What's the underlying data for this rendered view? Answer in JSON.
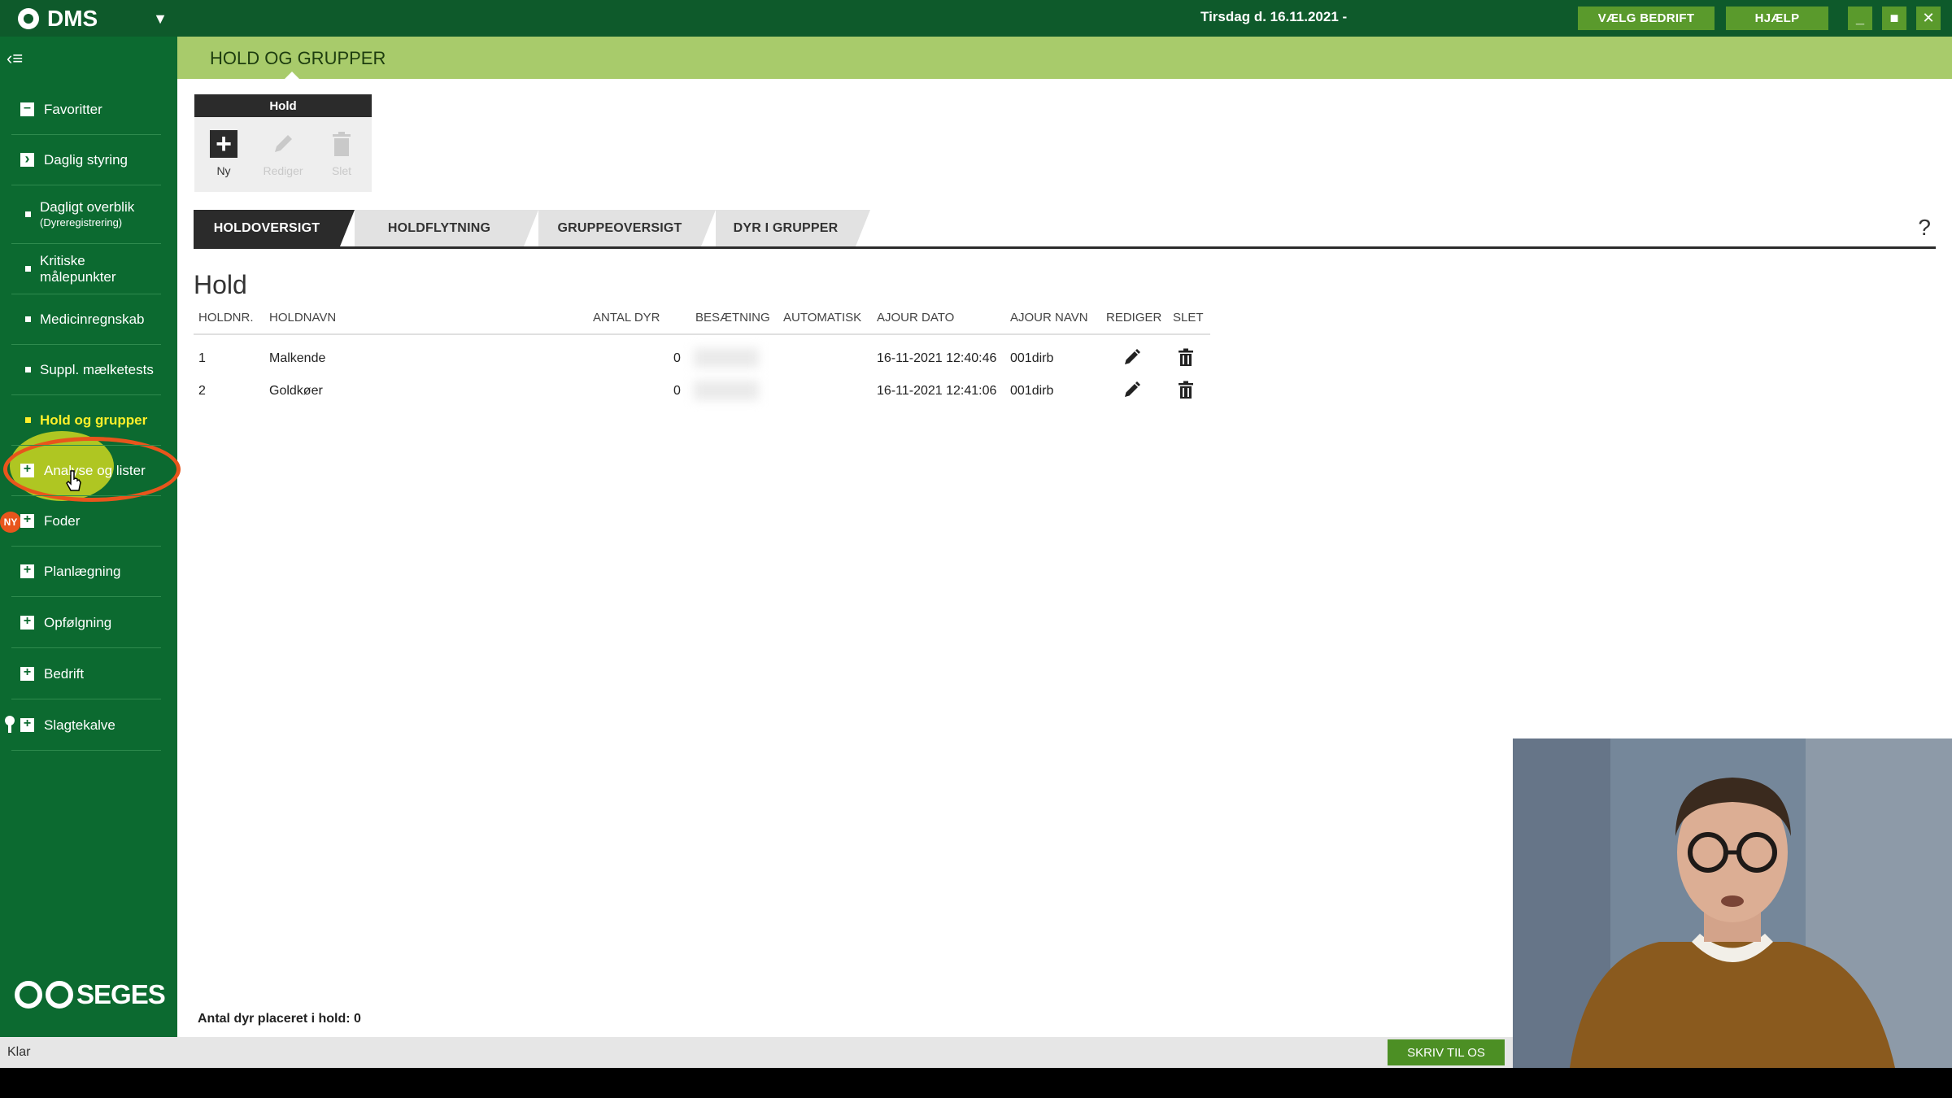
{
  "titlebar": {
    "app_name": "DMS",
    "date": "Tirsdag d. 16.11.2021 -",
    "buttons": {
      "vaelg_bedrift": "VÆLG BEDRIFT",
      "hjaelp": "HJÆLP"
    },
    "window": {
      "minimize": "_",
      "maximize": "■",
      "close": "✕"
    }
  },
  "sidebar": {
    "items": [
      {
        "label": "Favoritter",
        "icon": "minus-box-icon"
      },
      {
        "label": "Daglig styring",
        "icon": "chevron-right-box-icon"
      },
      {
        "label": "Dagligt overblik",
        "sub": "(Dyreregistrering)",
        "icon": "bullet"
      },
      {
        "label": "Kritiske målepunkter",
        "icon": "bullet"
      },
      {
        "label": "Medicinregnskab",
        "icon": "bullet"
      },
      {
        "label": "Suppl. mælketests",
        "icon": "bullet"
      },
      {
        "label": "Hold og grupper",
        "icon": "bullet",
        "active": true
      },
      {
        "label": "Analyse og lister",
        "icon": "plus-box-icon",
        "badge": "NY"
      },
      {
        "label": "Foder",
        "icon": "plus-box-icon"
      },
      {
        "label": "Planlægning",
        "icon": "plus-box-icon"
      },
      {
        "label": "Opfølgning",
        "icon": "plus-box-icon"
      },
      {
        "label": "Bedrift",
        "icon": "plus-box-icon"
      },
      {
        "label": "Slagtekalve",
        "icon": "plus-box-icon"
      }
    ],
    "brand": "SEGES"
  },
  "header": {
    "title": "HOLD OG GRUPPER"
  },
  "toolbar": {
    "group_title": "Hold",
    "new_label": "Ny",
    "edit_label": "Rediger",
    "delete_label": "Slet"
  },
  "tabs": [
    "HOLDOVERSIGT",
    "HOLDFLYTNING",
    "GRUPPEOVERSIGT",
    "DYR I GRUPPER"
  ],
  "help": "?",
  "section": {
    "title": "Hold",
    "columns": [
      "HOLDNR.",
      "HOLDNAVN",
      "ANTAL DYR",
      "BESÆTNING",
      "AUTOMATISK",
      "AJOUR DATO",
      "AJOUR NAVN",
      "REDIGER",
      "SLET"
    ],
    "rows": [
      {
        "nr": "1",
        "name": "Malkende",
        "antal": "0",
        "dato": "16-11-2021 12:40:46",
        "ajour_navn": "001dirb"
      },
      {
        "nr": "2",
        "name": "Goldkøer",
        "antal": "0",
        "dato": "16-11-2021 12:41:06",
        "ajour_navn": "001dirb"
      }
    ],
    "footer": "Antal dyr placeret i hold: 0"
  },
  "statusbar": {
    "status": "Klar",
    "contact_button": "SKRIV TIL OS"
  },
  "colors": {
    "titlebar": "#0e5a2b",
    "sidebar": "#0c6a30",
    "header_band": "#a8cb6b",
    "accent_button": "#5a9a2c",
    "highlight": "#e8551c"
  }
}
